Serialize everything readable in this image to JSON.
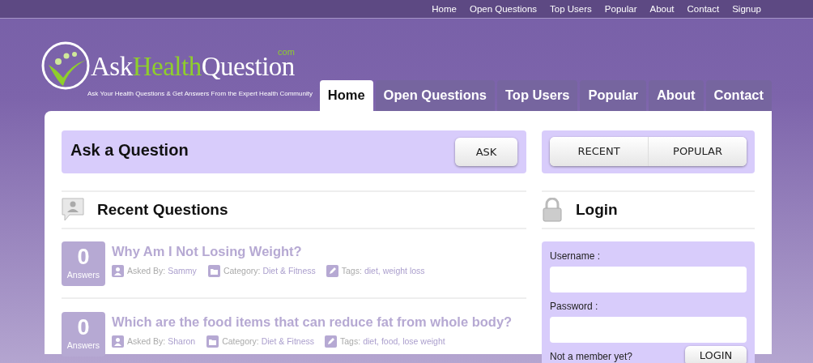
{
  "top_links": [
    {
      "label": "Home"
    },
    {
      "label": "Open Questions"
    },
    {
      "label": "Top Users"
    },
    {
      "label": "Popular"
    },
    {
      "label": "About"
    },
    {
      "label": "Contact"
    },
    {
      "label": "Signup"
    }
  ],
  "logo": {
    "word_1": "Ask",
    "word_2": "Health",
    "word_3": "Question",
    "suffix": "com",
    "tagline": "Ask Your Health Questions & Get Answers From the Expert Health Community"
  },
  "tabs": [
    {
      "label": "Home",
      "selected": true
    },
    {
      "label": "Open Questions",
      "selected": false
    },
    {
      "label": "Top Users",
      "selected": false
    },
    {
      "label": "Popular",
      "selected": false
    },
    {
      "label": "About",
      "selected": false
    },
    {
      "label": "Contact",
      "selected": false
    }
  ],
  "ask_box": {
    "title": "Ask a Question",
    "button": "ASK"
  },
  "recent_heading": "Recent Questions",
  "questions": [
    {
      "count": "0",
      "count_label": "Answers",
      "title": "Why Am I Not Losing Weight?",
      "asked_label": "Asked By:",
      "author": "Sammy",
      "category_label": "Category:",
      "category": "Diet & Fitness",
      "tags_label": "Tags:",
      "tags": "diet, weight loss"
    },
    {
      "count": "0",
      "count_label": "Answers",
      "title": "Which are the food items that can reduce fat from whole body?",
      "asked_label": "Asked By:",
      "author": "Sharon",
      "category_label": "Category:",
      "category": "Diet & Fitness",
      "tags_label": "Tags:",
      "tags": "diet, food, lose weight"
    }
  ],
  "sort_buttons": [
    {
      "label": "RECENT"
    },
    {
      "label": "POPULAR"
    }
  ],
  "login": {
    "heading": "Login",
    "username_label": "Username :",
    "password_label": "Password :",
    "member_text": "Not a member yet?",
    "button": "LOGIN"
  }
}
